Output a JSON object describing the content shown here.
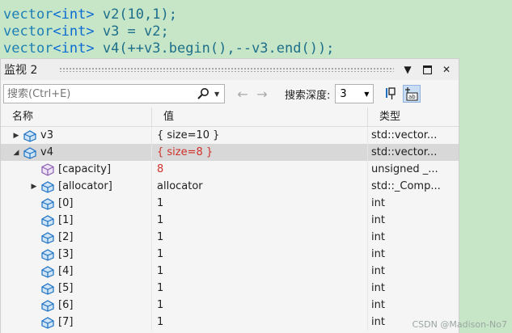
{
  "code": {
    "line1": {
      "kw": "vector",
      "tp": "<int>",
      "txt": " v2(10,1);"
    },
    "line2": {
      "kw": "vector",
      "tp": "<int>",
      "txt": " v3 = v2;"
    },
    "line3": {
      "kw": "vector",
      "tp": "<int>",
      "txt": " v4(++v3.begin(),--v3.end());"
    }
  },
  "watch": {
    "title": "监视 2",
    "search_placeholder": "搜索(Ctrl+E)",
    "depth_label": "搜索深度:",
    "depth_value": "3",
    "columns": {
      "name": "名称",
      "value": "值",
      "type": "类型"
    },
    "rows": {
      "r0": {
        "name": "v3",
        "value": "{ size=10 }",
        "type": "std::vector..."
      },
      "r1": {
        "name": "v4",
        "value": "{ size=8 }",
        "type": "std::vector..."
      },
      "r2": {
        "name": "[capacity]",
        "value": "8",
        "type": "unsigned _..."
      },
      "r3": {
        "name": "[allocator]",
        "value": "allocator",
        "type": "std::_Comp..."
      },
      "r4": {
        "name": "[0]",
        "value": "1",
        "type": "int"
      },
      "r5": {
        "name": "[1]",
        "value": "1",
        "type": "int"
      },
      "r6": {
        "name": "[2]",
        "value": "1",
        "type": "int"
      },
      "r7": {
        "name": "[3]",
        "value": "1",
        "type": "int"
      },
      "r8": {
        "name": "[4]",
        "value": "1",
        "type": "int"
      },
      "r9": {
        "name": "[5]",
        "value": "1",
        "type": "int"
      },
      "r10": {
        "name": "[6]",
        "value": "1",
        "type": "int"
      },
      "r11": {
        "name": "[7]",
        "value": "1",
        "type": "int"
      }
    }
  },
  "watermark": "CSDN @Madison-No7",
  "colors": {
    "background": "#c7e6c7",
    "changed_value": "#d0302a",
    "selected_row": "#d8d8d8"
  }
}
